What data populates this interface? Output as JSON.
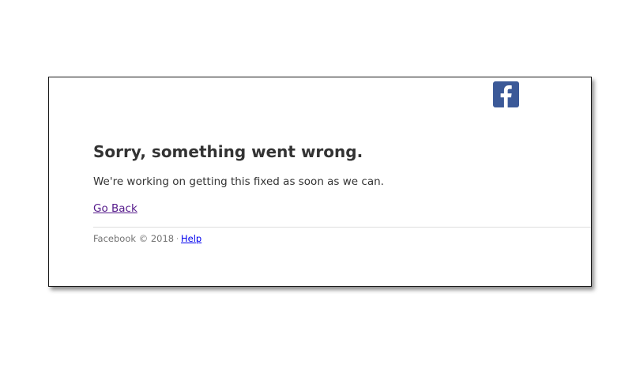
{
  "brand": {
    "logo_icon": "facebook-f-icon",
    "color": "#3b5998",
    "logo_text": "f"
  },
  "error": {
    "title": "Sorry, something went wrong.",
    "message": "We're working on getting this fixed as soon as we can.",
    "go_back_label": "Go Back"
  },
  "footer": {
    "copyright": "Facebook © 2018",
    "separator": "·",
    "help_label": "Help"
  }
}
